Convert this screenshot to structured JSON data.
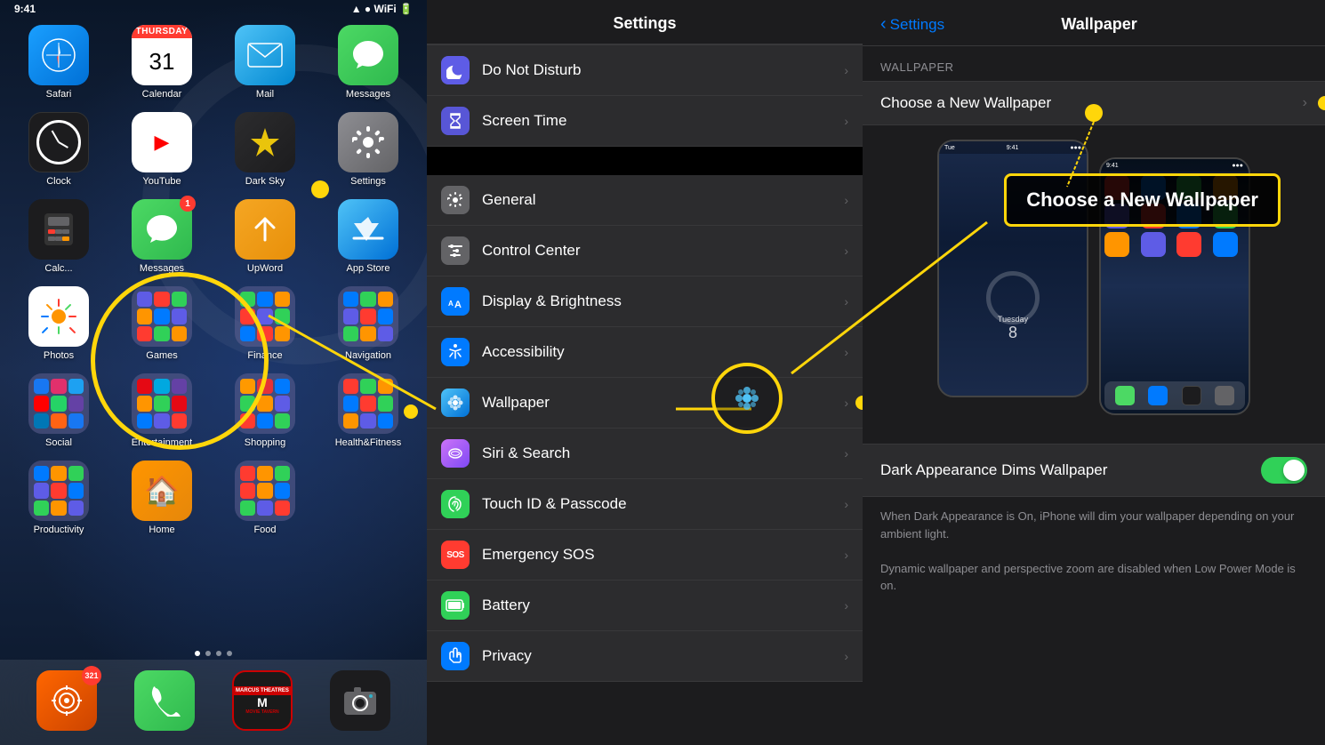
{
  "homeScreen": {
    "statusBar": {
      "time": "9:41",
      "signal": "●●●●○",
      "wifi": "WiFi",
      "battery": "100%"
    },
    "apps": [
      {
        "id": "safari",
        "label": "Safari",
        "type": "safari"
      },
      {
        "id": "calendar",
        "label": "Calendar",
        "type": "calendar",
        "headerText": "Thursday",
        "dayText": "31"
      },
      {
        "id": "mail",
        "label": "Mail",
        "type": "mail"
      },
      {
        "id": "messages",
        "label": "Messages",
        "type": "messages"
      },
      {
        "id": "clock",
        "label": "Clock",
        "type": "clock"
      },
      {
        "id": "youtube",
        "label": "YouTube",
        "type": "youtube"
      },
      {
        "id": "darksky",
        "label": "Dark Sky",
        "type": "darksky"
      },
      {
        "id": "settings",
        "label": "Settings",
        "type": "settings"
      },
      {
        "id": "calculator",
        "label": "Calculator",
        "type": "calculator"
      },
      {
        "id": "messages2",
        "label": "Messages",
        "type": "messages2",
        "badge": "1"
      },
      {
        "id": "upword",
        "label": "UpWord",
        "type": "upword"
      },
      {
        "id": "appstore",
        "label": "App Store",
        "type": "appstore"
      },
      {
        "id": "photos",
        "label": "Photos",
        "type": "photos"
      },
      {
        "id": "games",
        "label": "Games",
        "type": "games"
      },
      {
        "id": "finance",
        "label": "Finance",
        "type": "finance"
      },
      {
        "id": "navigation",
        "label": "Navigation",
        "type": "navigation"
      },
      {
        "id": "social",
        "label": "Social",
        "type": "social"
      },
      {
        "id": "entertainment",
        "label": "Entertainment",
        "type": "entertainment"
      },
      {
        "id": "shopping",
        "label": "Shopping",
        "type": "shopping"
      },
      {
        "id": "healthfitness",
        "label": "Health&Fitness",
        "type": "healthfitness"
      },
      {
        "id": "productivity",
        "label": "Productivity",
        "type": "productivity"
      },
      {
        "id": "home",
        "label": "Home",
        "type": "home"
      },
      {
        "id": "food",
        "label": "Food",
        "type": "food"
      }
    ],
    "dock": [
      {
        "id": "overcast",
        "label": "Overcast",
        "badge": "321"
      },
      {
        "id": "phone",
        "label": "Phone"
      },
      {
        "id": "marcus",
        "label": "Marcus Theatres"
      },
      {
        "id": "camera",
        "label": "Camera"
      }
    ]
  },
  "settingsPanel": {
    "title": "Settings",
    "items": [
      {
        "id": "do-not-disturb",
        "label": "Do Not Disturb",
        "iconType": "moon",
        "iconColor": "#5e5ce6"
      },
      {
        "id": "screen-time",
        "label": "Screen Time",
        "iconType": "hourglass",
        "iconColor": "#5856d6"
      },
      {
        "id": "separator"
      },
      {
        "id": "general",
        "label": "General",
        "iconType": "gear",
        "iconColor": "#636366"
      },
      {
        "id": "control-center",
        "label": "Control Center",
        "iconType": "sliders",
        "iconColor": "#636366"
      },
      {
        "id": "display-brightness",
        "label": "Display & Brightness",
        "iconType": "text-aa",
        "iconColor": "#007aff"
      },
      {
        "id": "accessibility",
        "label": "Accessibility",
        "iconType": "accessibility",
        "iconColor": "#007aff"
      },
      {
        "id": "wallpaper",
        "label": "Wallpaper",
        "iconType": "flowers",
        "iconColor": "#007aff",
        "highlighted": true
      },
      {
        "id": "siri-search",
        "label": "Siri & Search",
        "iconType": "siri",
        "iconColor": "#8e8e93"
      },
      {
        "id": "touch-id",
        "label": "Touch ID & Passcode",
        "iconType": "fingerprint",
        "iconColor": "#30d158"
      },
      {
        "id": "emergency-sos",
        "label": "Emergency SOS",
        "iconType": "sos",
        "iconColor": "#ff3b30"
      },
      {
        "id": "battery",
        "label": "Battery",
        "iconType": "battery",
        "iconColor": "#30d158"
      },
      {
        "id": "privacy",
        "label": "Privacy",
        "iconType": "hand",
        "iconColor": "#007aff"
      }
    ]
  },
  "wallpaperPanel": {
    "backLabel": "Settings",
    "title": "Wallpaper",
    "sectionLabel": "WALLPAPER",
    "chooseLabel": "Choose a New Wallpaper",
    "darkAppearanceLabel": "Dark Appearance Dims Wallpaper",
    "darkAppearanceEnabled": true,
    "descriptionLine1": "When Dark Appearance is On, iPhone will dim your wallpaper depending on your ambient light.",
    "descriptionLine2": "Dynamic wallpaper and perspective zoom are disabled when Low Power Mode is on.",
    "calloutText": "Choose a New Wallpaper"
  }
}
